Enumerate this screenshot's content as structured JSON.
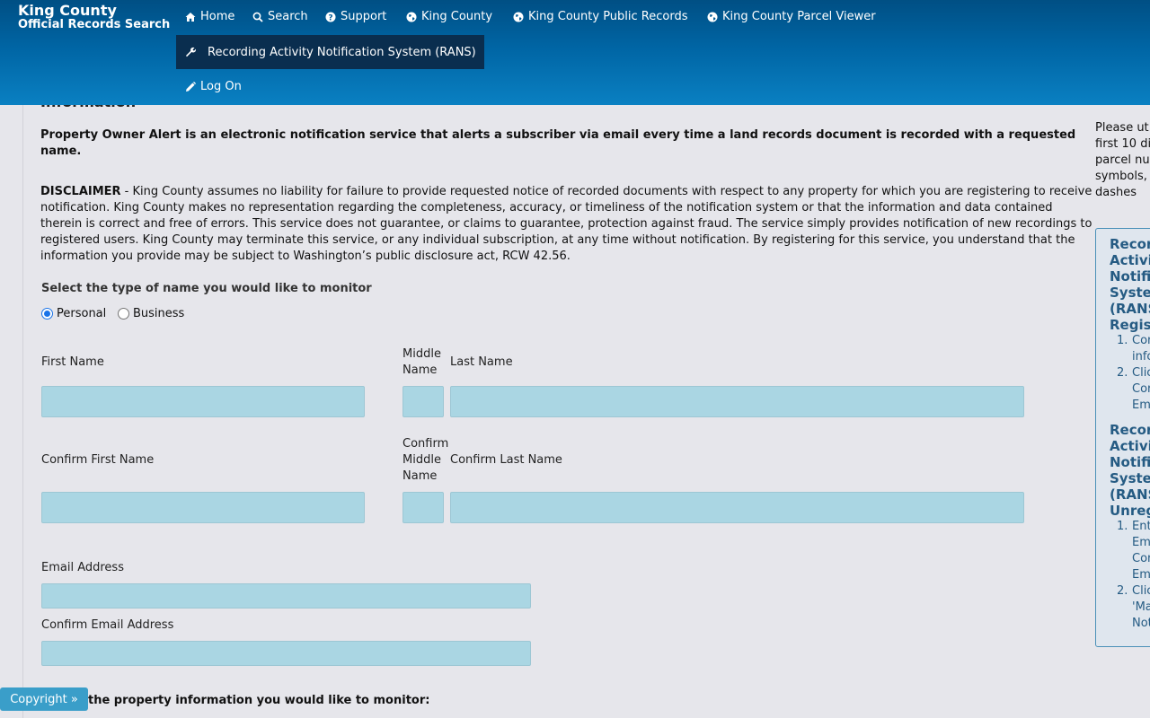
{
  "header": {
    "brand_line1": "King County",
    "brand_line2": "Official Records Search",
    "nav": {
      "home": "Home",
      "search": "Search",
      "support": "Support",
      "king_county": "King County",
      "public_records": "King County Public Records",
      "parcel_viewer": "King County Parcel Viewer",
      "rans": "Recording Activity Notification System (RANS)",
      "logon": "Log On"
    }
  },
  "main": {
    "section_heading": "Information",
    "intro": "Property Owner Alert is an electronic notification service that alerts a subscriber via email every time a land records document is recorded with a requested name.",
    "disclaimer_label": "DISCLAIMER",
    "disclaimer_text": " - King County assumes no liability for failure to provide requested notice of recorded documents with respect to any property for which you are registering to receive notification. King County makes no representation regarding the completeness, accuracy, or timeliness of the notification system or that the information and data contained therein is correct and free of errors. This service does not guarantee, or claims to guarantee, protection against fraud. The service simply provides notification of new recordings to registered users. King County may terminate this service, or any individual subscription, at any time without notification. By registering for this service, you understand that the information you provide may be subject to Washington’s public disclosure act, RCW 42.56.",
    "name_type_label": "Select the type of name you would like to monitor",
    "radio_personal": "Personal",
    "radio_business": "Business",
    "selected_type": "Personal",
    "first_name_label": "First Name",
    "middle_name_label_1": "Middle",
    "middle_name_label_2": "Name",
    "last_name_label": "Last Name",
    "confirm_first_name_label": "Confirm First Name",
    "confirm_middle_label_1": "Confirm",
    "confirm_middle_label_2": "Middle",
    "confirm_middle_label_3": "Name",
    "confirm_last_name_label": "Confirm Last Name",
    "email_label": "Email Address",
    "confirm_email_label": "Confirm Email Address",
    "property_label": "the property information you would like to monitor:"
  },
  "right": {
    "note_lines": [
      "Please ut",
      "first 10 di",
      "parcel nu",
      "symbols,",
      "dashes"
    ],
    "box1_title_lines": [
      "Recor",
      "Activi",
      "Notific",
      "Syster",
      "(RANS",
      "Regist"
    ],
    "box1_steps": [
      {
        "num": "1.",
        "lines": [
          "Cor",
          "info"
        ]
      },
      {
        "num": "2.",
        "lines": [
          "Clic",
          "Cor",
          "Em"
        ]
      }
    ],
    "box2_title_lines": [
      "Recor",
      "Activi",
      "Notific",
      "Syster",
      "(RANS",
      "Unreg"
    ],
    "box2_steps": [
      {
        "num": "1.",
        "lines": [
          "Ent",
          "Em",
          "Cor",
          "Em"
        ]
      },
      {
        "num": "2.",
        "lines": [
          "Clic",
          "'Ma",
          "Not"
        ]
      }
    ]
  },
  "footer": {
    "copyright": "Copyright »"
  }
}
